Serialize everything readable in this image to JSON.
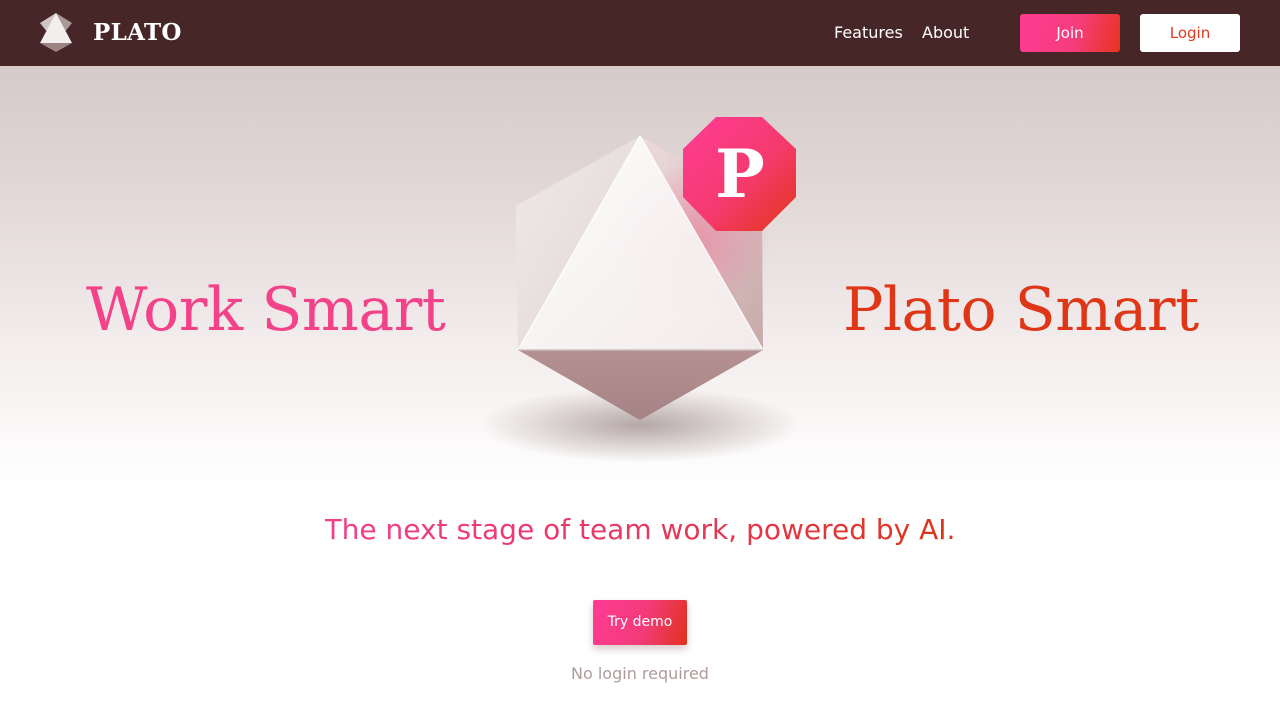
{
  "navbar": {
    "brand_name": "PLATO",
    "logo_icon": "octahedron-logo-icon",
    "links": [
      "Features",
      "About"
    ],
    "join_label": "Join",
    "login_label": "Login",
    "background_color": "#472627"
  },
  "hero": {
    "headline_left": "Work Smart",
    "headline_right": "Plato Smart",
    "badge_letter": "P",
    "illustration": "octahedron-crystal-icon",
    "colors": {
      "pink": "#f3428a",
      "red_orange": "#df3617"
    }
  },
  "tagline": "The next stage of team work, powered by AI.",
  "cta": {
    "demo_label": "Try demo",
    "demo_note": "No login required"
  }
}
